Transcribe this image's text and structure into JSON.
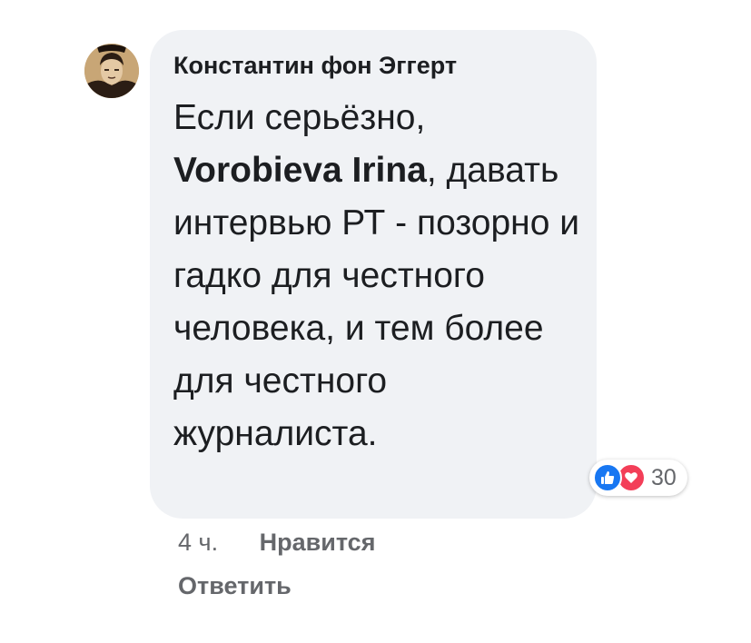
{
  "comment": {
    "author": "Константин фон Эггерт",
    "avatar_icon": "person-portrait-icon",
    "text_before": "Если серьёзно, ",
    "mention": "Vorobieva Irina",
    "text_after": ", давать интервью РТ - позорно и гадко для честного человека, и тем более для честного журналиста.",
    "reactions": {
      "icons": [
        "like-icon",
        "love-icon"
      ],
      "count": "30",
      "like_color": "#1877f2",
      "love_color": "#f33e58"
    }
  },
  "actions": {
    "time": "4 ч.",
    "like_label": "Нравится",
    "reply_label": "Ответить"
  },
  "colors": {
    "bubble_bg": "#f0f2f5",
    "text": "#1c1e21",
    "secondary": "#65676b"
  }
}
